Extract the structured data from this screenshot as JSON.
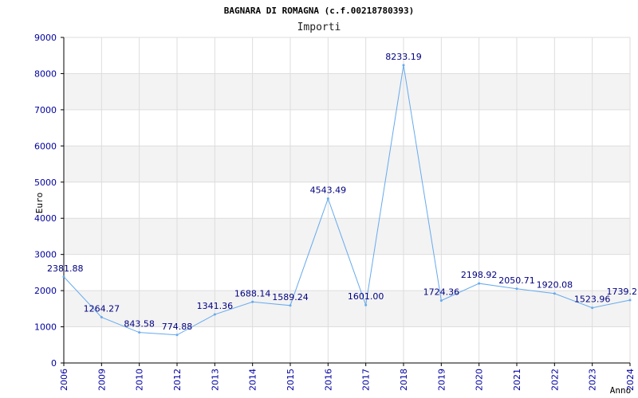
{
  "chart_data": {
    "type": "line",
    "title": "BAGNARA DI ROMAGNA (c.f.00218780393)",
    "subtitle": "Importi",
    "xlabel": "Anno",
    "ylabel": "Euro",
    "ylim": [
      0,
      9000
    ],
    "yticks": [
      0,
      1000,
      2000,
      3000,
      4000,
      5000,
      6000,
      7000,
      8000,
      9000
    ],
    "grid": true,
    "x": [
      "2006",
      "2009",
      "2010",
      "2012",
      "2013",
      "2014",
      "2015",
      "2016",
      "2017",
      "2018",
      "2019",
      "2020",
      "2021",
      "2022",
      "2023",
      "2024"
    ],
    "series": [
      {
        "values": [
          2381.88,
          1264.27,
          843.58,
          774.88,
          1341.36,
          1688.14,
          1589.24,
          4543.49,
          1601.0,
          8233.19,
          1724.36,
          2198.92,
          2050.71,
          1920.08,
          1523.96,
          1739.2
        ],
        "labels": [
          "2381.88",
          "1264.27",
          "843.58",
          "774.88",
          "1341.36",
          "1688.14",
          "1589.24",
          "4543.49",
          "1601.00",
          "8233.19",
          "1724.36",
          "2198.92",
          "2050.71",
          "1920.08",
          "1523.96",
          "1739.2"
        ]
      }
    ],
    "colors": {
      "line": "#66aaee",
      "band": "#f3f3f3",
      "grid": "#dddddd",
      "axis": "#000000",
      "tick_text": "#0000a0",
      "label_text": "#000080"
    }
  }
}
